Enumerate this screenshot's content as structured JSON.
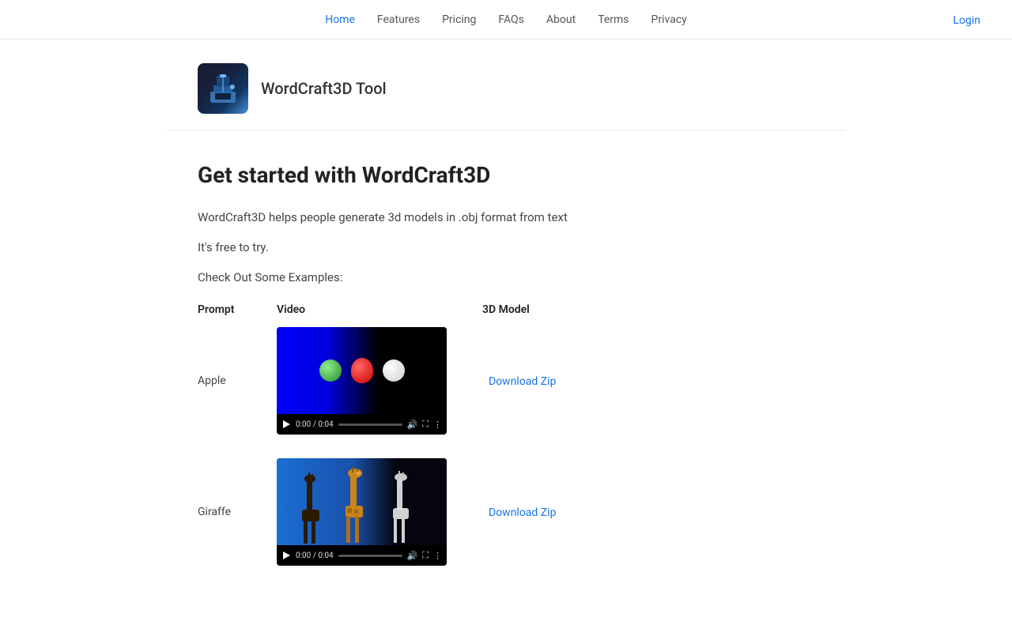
{
  "nav": {
    "links": [
      {
        "label": "Home",
        "active": true,
        "name": "home"
      },
      {
        "label": "Features",
        "active": false,
        "name": "features"
      },
      {
        "label": "Pricing",
        "active": false,
        "name": "pricing"
      },
      {
        "label": "FAQs",
        "active": false,
        "name": "faqs"
      },
      {
        "label": "About",
        "active": false,
        "name": "about"
      },
      {
        "label": "Terms",
        "active": false,
        "name": "terms"
      },
      {
        "label": "Privacy",
        "active": false,
        "name": "privacy"
      }
    ],
    "login_label": "Login"
  },
  "logo": {
    "title": "WordCraft3D Tool"
  },
  "hero": {
    "heading": "Get started with WordCraft3D",
    "description": "WordCraft3D helps people generate 3d models in .obj format from text",
    "free_text": "It's free to try.",
    "examples_heading": "Check Out Some Examples:"
  },
  "table": {
    "headers": {
      "prompt": "Prompt",
      "video": "Video",
      "model": "3D Model"
    },
    "rows": [
      {
        "prompt": "Apple",
        "video_type": "apple",
        "time_display": "0:00 / 0:04",
        "download_label": "Download Zip"
      },
      {
        "prompt": "Giraffe",
        "video_type": "giraffe",
        "time_display": "0:00 / 0:04",
        "download_label": "Download Zip"
      }
    ]
  }
}
